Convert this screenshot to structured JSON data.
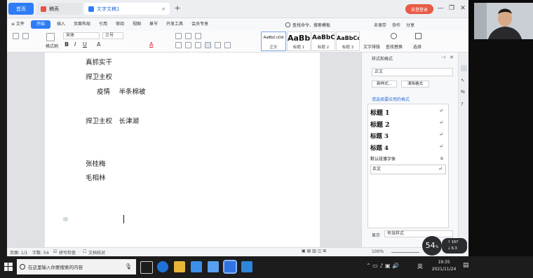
{
  "tabs": {
    "home": "首页",
    "draft": "稿壳",
    "document": "文字文稿1",
    "add": "+"
  },
  "window": {
    "login": "去登登录",
    "minimize": "—",
    "restore": "❐",
    "close": "✕"
  },
  "menu": {
    "items": [
      "≡ 文件",
      "开始",
      "插入",
      "页面布局",
      "引用",
      "审阅",
      "视图",
      "章节",
      "开发工具",
      "会员专享"
    ],
    "active_index": 1,
    "search": "查找命令、搜索模板",
    "right": [
      "未保存",
      "协作",
      "分享"
    ]
  },
  "ribbon": {
    "paste": "粘贴",
    "format_painter": "格式刷",
    "font_name": "宋体",
    "font_size": "三号",
    "styles": [
      {
        "sample": "AaBbCcDd",
        "name": "正文"
      },
      {
        "sample": "AaBb",
        "name": "标题 1"
      },
      {
        "sample": "AaBbC",
        "name": "标题 2"
      },
      {
        "sample": "AaBbCc",
        "name": "标题 3"
      }
    ],
    "text_tools": "文字排版",
    "find_replace": "查找替换",
    "select": "选择"
  },
  "document": {
    "lines": [
      "真抓实干",
      "捍卫主权",
      "疫情　 半条棉被",
      "捍卫主权　长津湖",
      "张桂梅",
      "毛相林"
    ]
  },
  "panel": {
    "title": "样式和格式",
    "current_style": "正文",
    "new_style": "新样式...",
    "clear_format": "清除格式",
    "apply_label": "请选择要应用的格式",
    "styles": [
      {
        "name": "标题  1"
      },
      {
        "name": "标题  2"
      },
      {
        "name": "标题  3"
      },
      {
        "name": "标题  4"
      },
      {
        "name": "默认段落字体"
      },
      {
        "name": "正文"
      }
    ],
    "show_label": "显示",
    "show_value": "有效样式"
  },
  "status": {
    "page": "页面: 1/1",
    "words": "字数: 54",
    "spell_check": "拼写检查",
    "doc_check": "文档校对",
    "zoom": "100%"
  },
  "overlay": {
    "zoom_level": "54",
    "zoom_unit": "%",
    "up_speed": "167",
    "down_speed": "6.3"
  },
  "taskbar": {
    "search_placeholder": "在这里输入你要搜索的内容",
    "time": "19:35",
    "date": "2021/11/24",
    "lang": "英"
  }
}
